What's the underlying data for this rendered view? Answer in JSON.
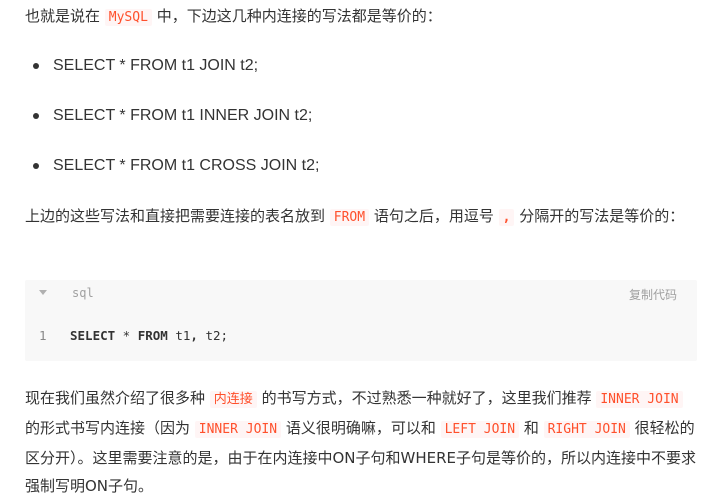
{
  "intro": {
    "prefix": "也就是说在 ",
    "code": "MySQL",
    "suffix": " 中，下边这几种内连接的写法都是等价的："
  },
  "bullets": [
    "SELECT * FROM t1 JOIN t2;",
    "SELECT * FROM t1 INNER JOIN t2;",
    "SELECT * FROM t1 CROSS JOIN t2;"
  ],
  "para2": {
    "prefix": "上边的这些写法和直接把需要连接的表名放到 ",
    "code1": "FROM",
    "middle": " 语句之后，用逗号 ",
    "code2": ",",
    "suffix": " 分隔开的写法是等价的："
  },
  "code_block": {
    "language": "sql",
    "copy_label": "复制代码",
    "line_number": "1",
    "kw_select": "SELECT",
    "star": " * ",
    "kw_from": "FROM",
    "rest_a": " t1",
    "comma": ",",
    "rest_b": " t2;"
  },
  "para3": {
    "t1": "现在我们虽然介绍了很多种 ",
    "c1": "内连接",
    "t2": " 的书写方式，不过熟悉一种就好了，这里我们推荐 ",
    "c2": "INNER JOIN",
    "t3": " 的形式书写内连接（因为 ",
    "c3": "INNER JOIN",
    "t4": " 语义很明确嘛，可以和 ",
    "c4": "LEFT JOIN",
    "t5": " 和 ",
    "c5": "RIGHT JOIN",
    "t6": " 很轻松的区分开）。这里需要注意的是，由于在内连接中ON子句和WHERE子句是等价的，所以内连接中不要求强制写明ON子句。"
  },
  "colors": {
    "inline_code": "#ff502c",
    "code_bg": "#f8f8f8",
    "text": "#333333"
  }
}
